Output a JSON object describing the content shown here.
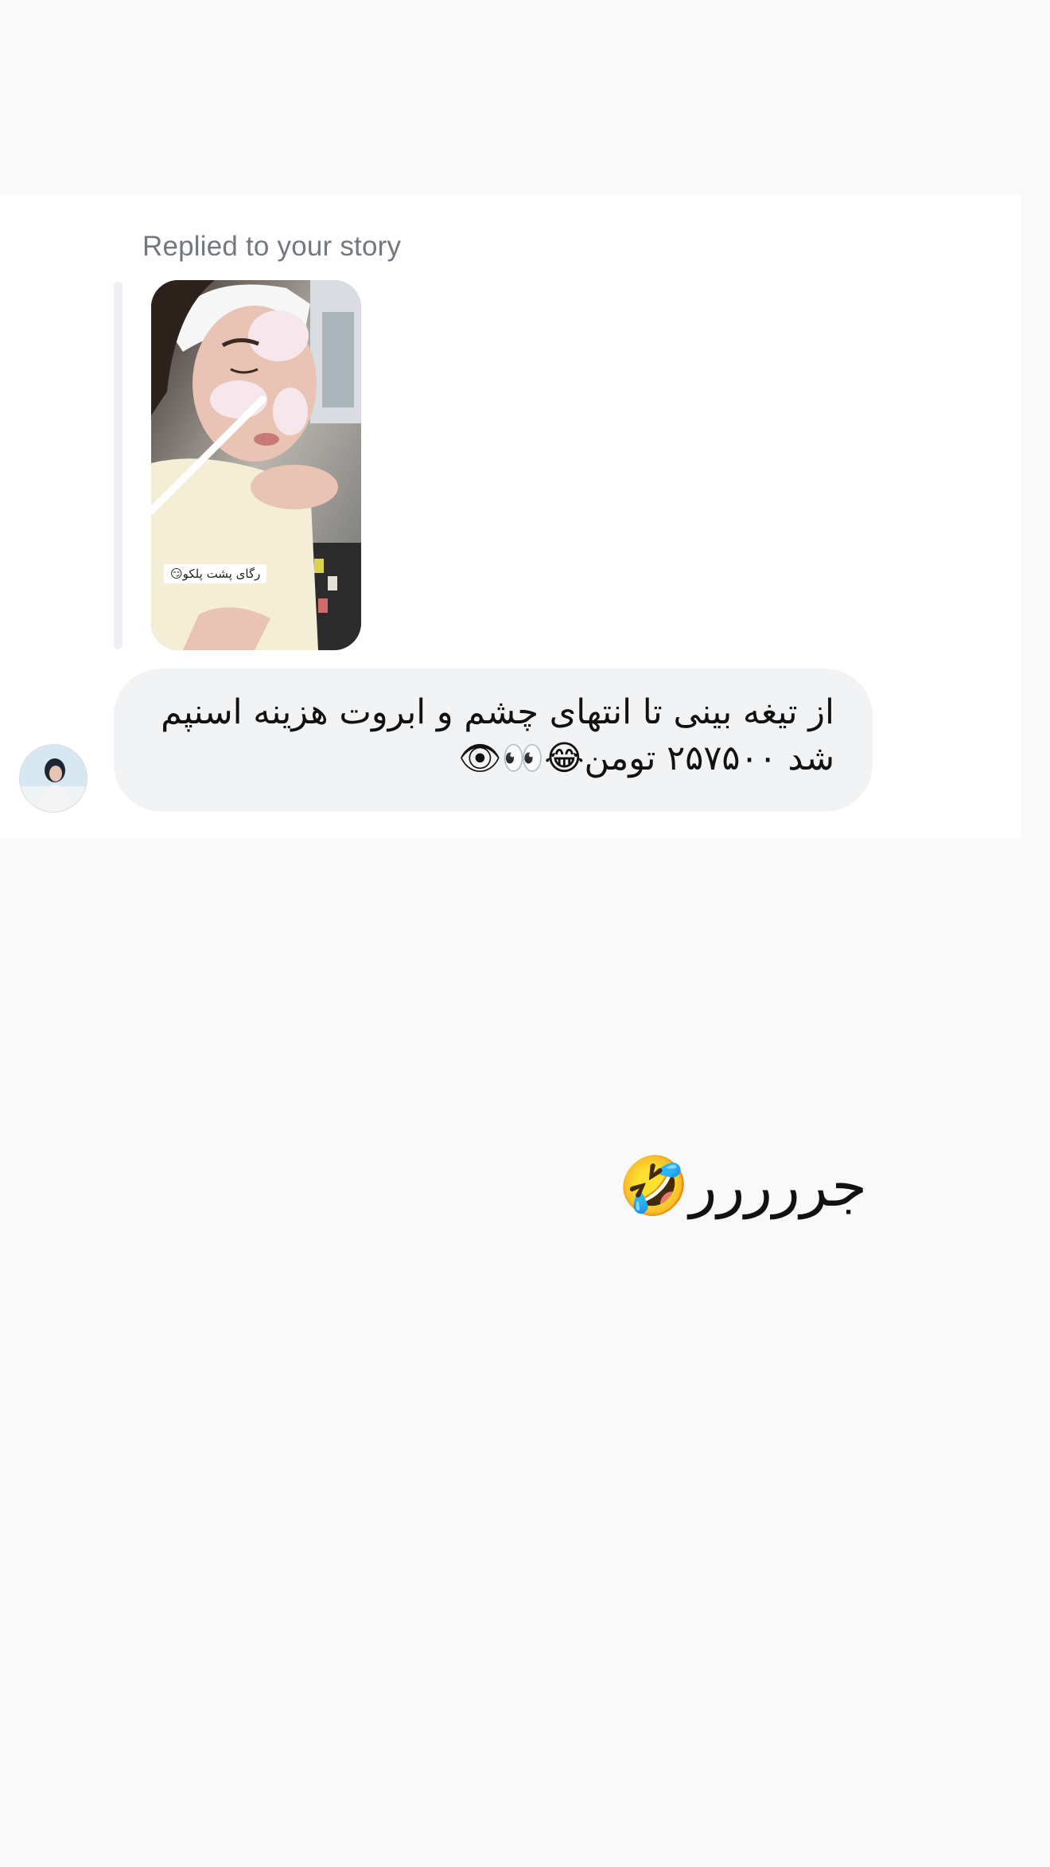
{
  "story_reply": {
    "label": "Replied to your story",
    "story_caption": "رگای پشت پلکو😏"
  },
  "received_message": {
    "text": "از تیغه بینی تا انتهای چشم و ابروت هزینه اسنپم شد ۲۵۷۵۰۰ تومن😂👀👁"
  },
  "sent_message": {
    "text": "جررررر🤣"
  }
}
